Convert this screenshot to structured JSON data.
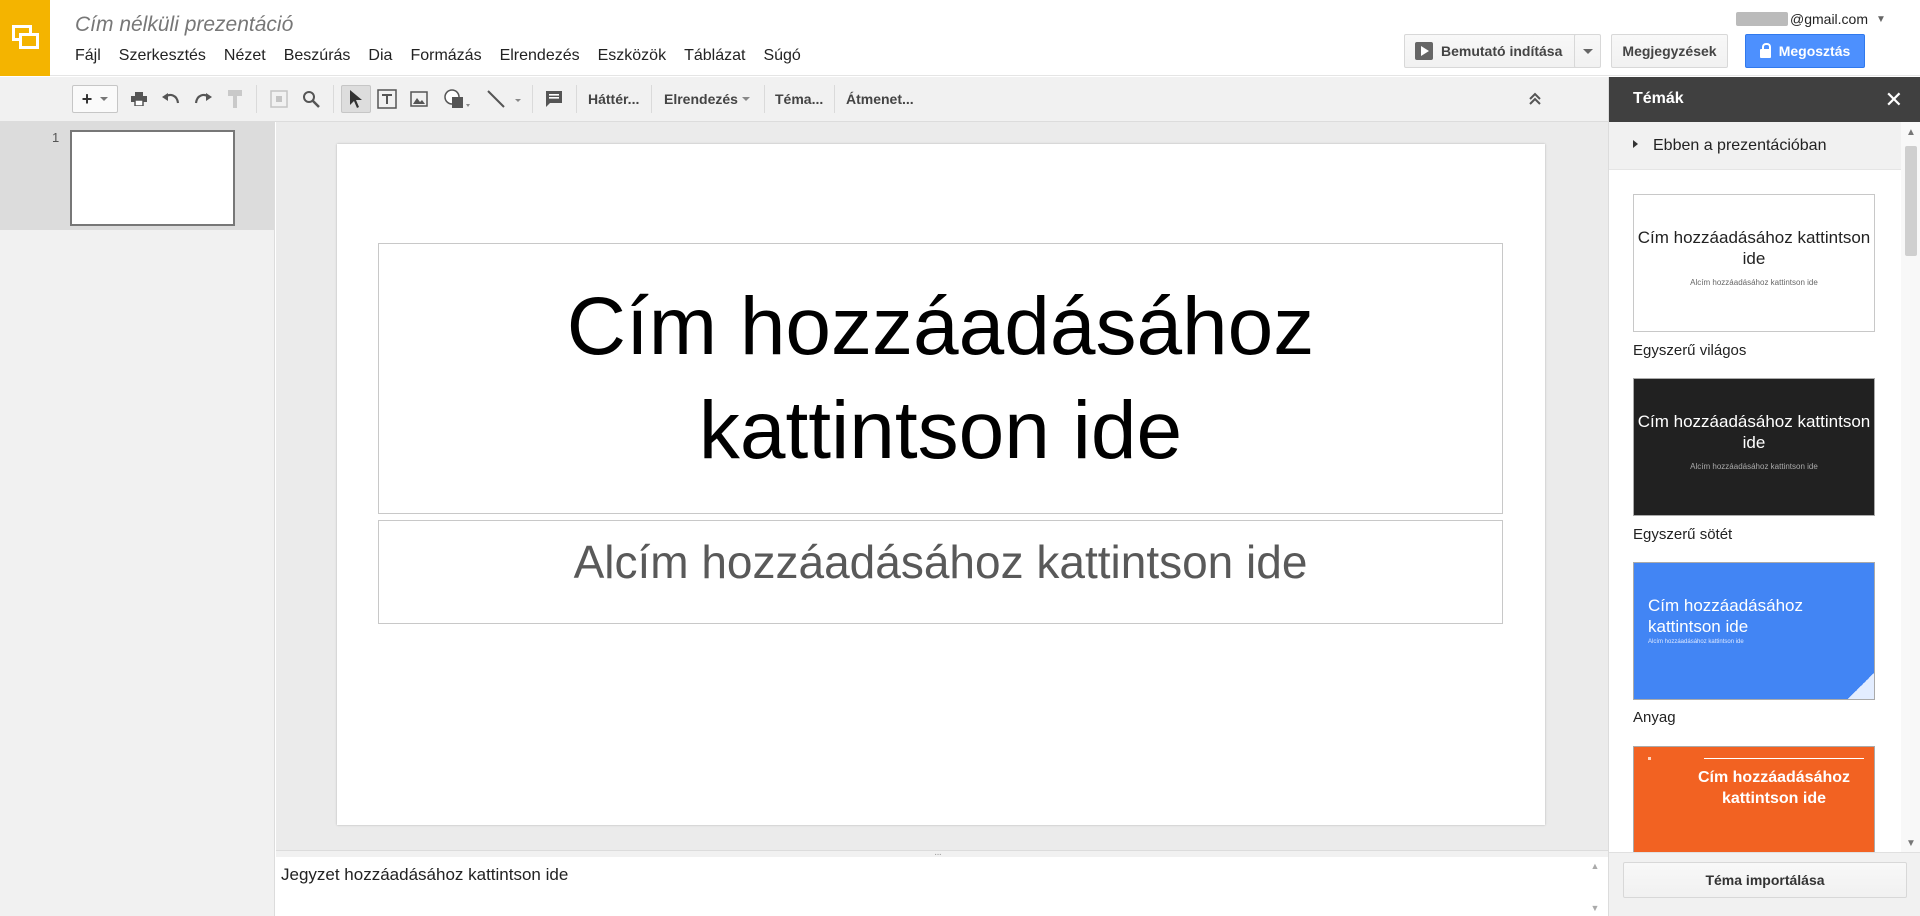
{
  "doc": {
    "title": "Cím nélküli prezentáció"
  },
  "menu": [
    "Fájl",
    "Szerkesztés",
    "Nézet",
    "Beszúrás",
    "Dia",
    "Formázás",
    "Elrendezés",
    "Eszközök",
    "Táblázat",
    "Súgó"
  ],
  "account": {
    "email_suffix": "@gmail.com"
  },
  "header_buttons": {
    "present": "Bemutató indítása",
    "notes": "Megjegyzések",
    "share": "Megosztás"
  },
  "toolbar": {
    "background": "Háttér...",
    "layout": "Elrendezés",
    "theme": "Téma...",
    "transition": "Átmenet..."
  },
  "filmstrip": {
    "slide_number": "1"
  },
  "slide": {
    "title_placeholder": "Cím hozzáadásához kattintson ide",
    "subtitle_placeholder": "Alcím hozzáadásához kattintson ide"
  },
  "notes": {
    "placeholder": "Jegyzet hozzáadásához kattintson ide"
  },
  "themes_panel": {
    "title": "Témák",
    "section": "Ebben a prezentációban",
    "card_title": "Cím hozzáadásához kattintson ide",
    "card_subtitle": "Alcím hozzáadásához kattintson ide",
    "themes": [
      {
        "name": "Egyszerű világos",
        "bg": "#ffffff"
      },
      {
        "name": "Egyszerű sötét",
        "bg": "#212121"
      },
      {
        "name": "Anyag",
        "bg": "#4285f4"
      },
      {
        "name": "",
        "bg": "#f26222"
      }
    ],
    "import_button": "Téma importálása"
  },
  "colors": {
    "accent": "#f4b400",
    "share_blue": "#4d90fe",
    "panel_header": "#404040"
  }
}
